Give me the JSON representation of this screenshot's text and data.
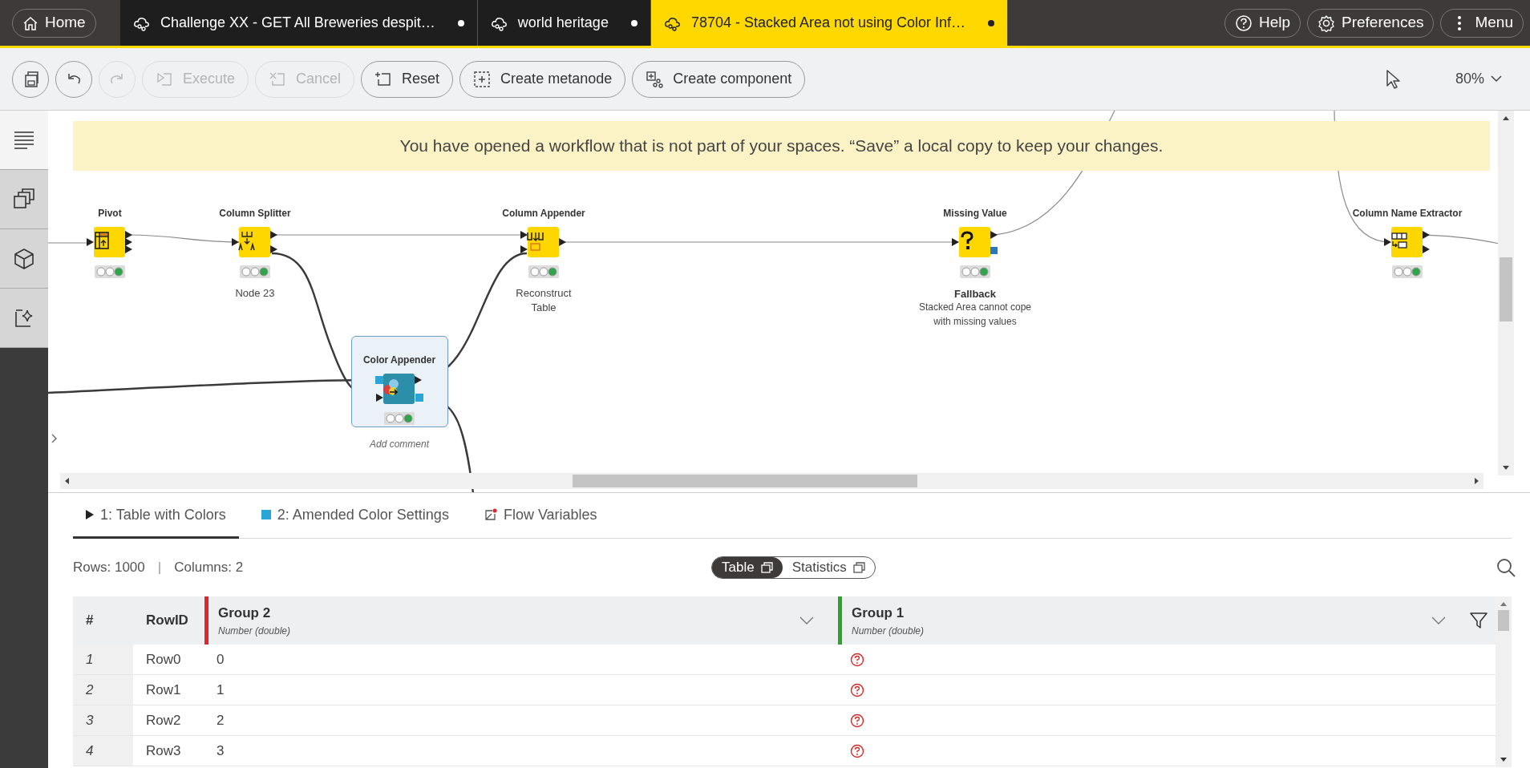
{
  "header_tabs": [
    {
      "kind": "home",
      "label": "Home",
      "selected": false
    },
    {
      "kind": "workflow",
      "label": "Challenge XX - GET All Breweries despit…",
      "selected": false,
      "modified": true
    },
    {
      "kind": "workflow",
      "label": "world heritage",
      "selected": false,
      "modified": true
    },
    {
      "kind": "workflow",
      "label": "78704 - Stacked Area not using Color Inf…",
      "selected": true,
      "modified": true
    }
  ],
  "header_buttons": [
    {
      "kind": "help",
      "label": "Help"
    },
    {
      "kind": "preferences",
      "label": "Preferences"
    },
    {
      "kind": "menu",
      "label": "Menu"
    }
  ],
  "toolbar": [
    {
      "kind": "save",
      "disabled": false
    },
    {
      "kind": "undo",
      "disabled": false
    },
    {
      "kind": "redo",
      "disabled": true
    },
    {
      "kind": "execute",
      "label": "Execute",
      "disabled": true
    },
    {
      "kind": "cancel",
      "label": "Cancel",
      "disabled": true
    },
    {
      "kind": "reset",
      "label": "Reset",
      "disabled": false
    },
    {
      "kind": "metanode",
      "label": "Create metanode",
      "disabled": false
    },
    {
      "kind": "component",
      "label": "Create component",
      "disabled": false
    }
  ],
  "zoom": "80%",
  "sidebar": [
    {
      "kind": "description",
      "selected": true
    },
    {
      "kind": "nodes",
      "selected": false
    },
    {
      "kind": "components",
      "selected": false
    },
    {
      "kind": "ai",
      "selected": false
    }
  ],
  "banner": "You have opened a workflow that is not part of your spaces. “Save” a local copy to keep your changes.",
  "nodes": [
    {
      "kind": "pivot",
      "title": "Pivot",
      "selected": false
    },
    {
      "kind": "splitter",
      "title": "Column Splitter",
      "selected": false,
      "label": "Node 23"
    },
    {
      "kind": "appender",
      "title": "Column Appender",
      "selected": false,
      "label": "Reconstruct Table"
    },
    {
      "kind": "missing",
      "title": "Missing Value",
      "selected": false,
      "annotation": {
        "heading": "Fallback",
        "text": "Stacked Area cannot cope with missing values"
      }
    },
    {
      "kind": "extractor",
      "title": "Column Name Extractor",
      "selected": false
    },
    {
      "kind": "color",
      "title": "Color Appender",
      "selected": true,
      "placeholder": "Add comment"
    }
  ],
  "output_tabs": [
    {
      "kind": "table",
      "label": "1: Table with Colors",
      "selected": true
    },
    {
      "kind": "color",
      "label": "2: Amended Color Settings",
      "selected": false
    },
    {
      "kind": "flow",
      "label": "Flow Variables",
      "selected": false
    }
  ],
  "table_info": {
    "rows": "Rows: 1000",
    "separator": "|",
    "columns": "Columns: 2"
  },
  "view_toggle": [
    {
      "label": "Table",
      "selected": true
    },
    {
      "label": "Statistics",
      "selected": false
    }
  ],
  "table": {
    "columns": [
      {
        "label": "#"
      },
      {
        "label": "RowID"
      },
      {
        "label": "Group 2",
        "type": "Number (double)",
        "color": "#e0262b"
      },
      {
        "label": "Group 1",
        "type": "Number (double)",
        "color": "#2ea12e"
      }
    ],
    "rows": [
      {
        "index": "1",
        "row_id": "Row0",
        "cells": [
          {
            "value": "0",
            "missing": false
          },
          {
            "missing": true
          }
        ]
      },
      {
        "index": "2",
        "row_id": "Row1",
        "cells": [
          {
            "value": "1",
            "missing": false
          },
          {
            "missing": true
          }
        ]
      },
      {
        "index": "3",
        "row_id": "Row2",
        "cells": [
          {
            "value": "2",
            "missing": false
          },
          {
            "missing": true
          }
        ]
      },
      {
        "index": "4",
        "row_id": "Row3",
        "cells": [
          {
            "value": "3",
            "missing": false
          },
          {
            "missing": true
          }
        ]
      }
    ]
  }
}
